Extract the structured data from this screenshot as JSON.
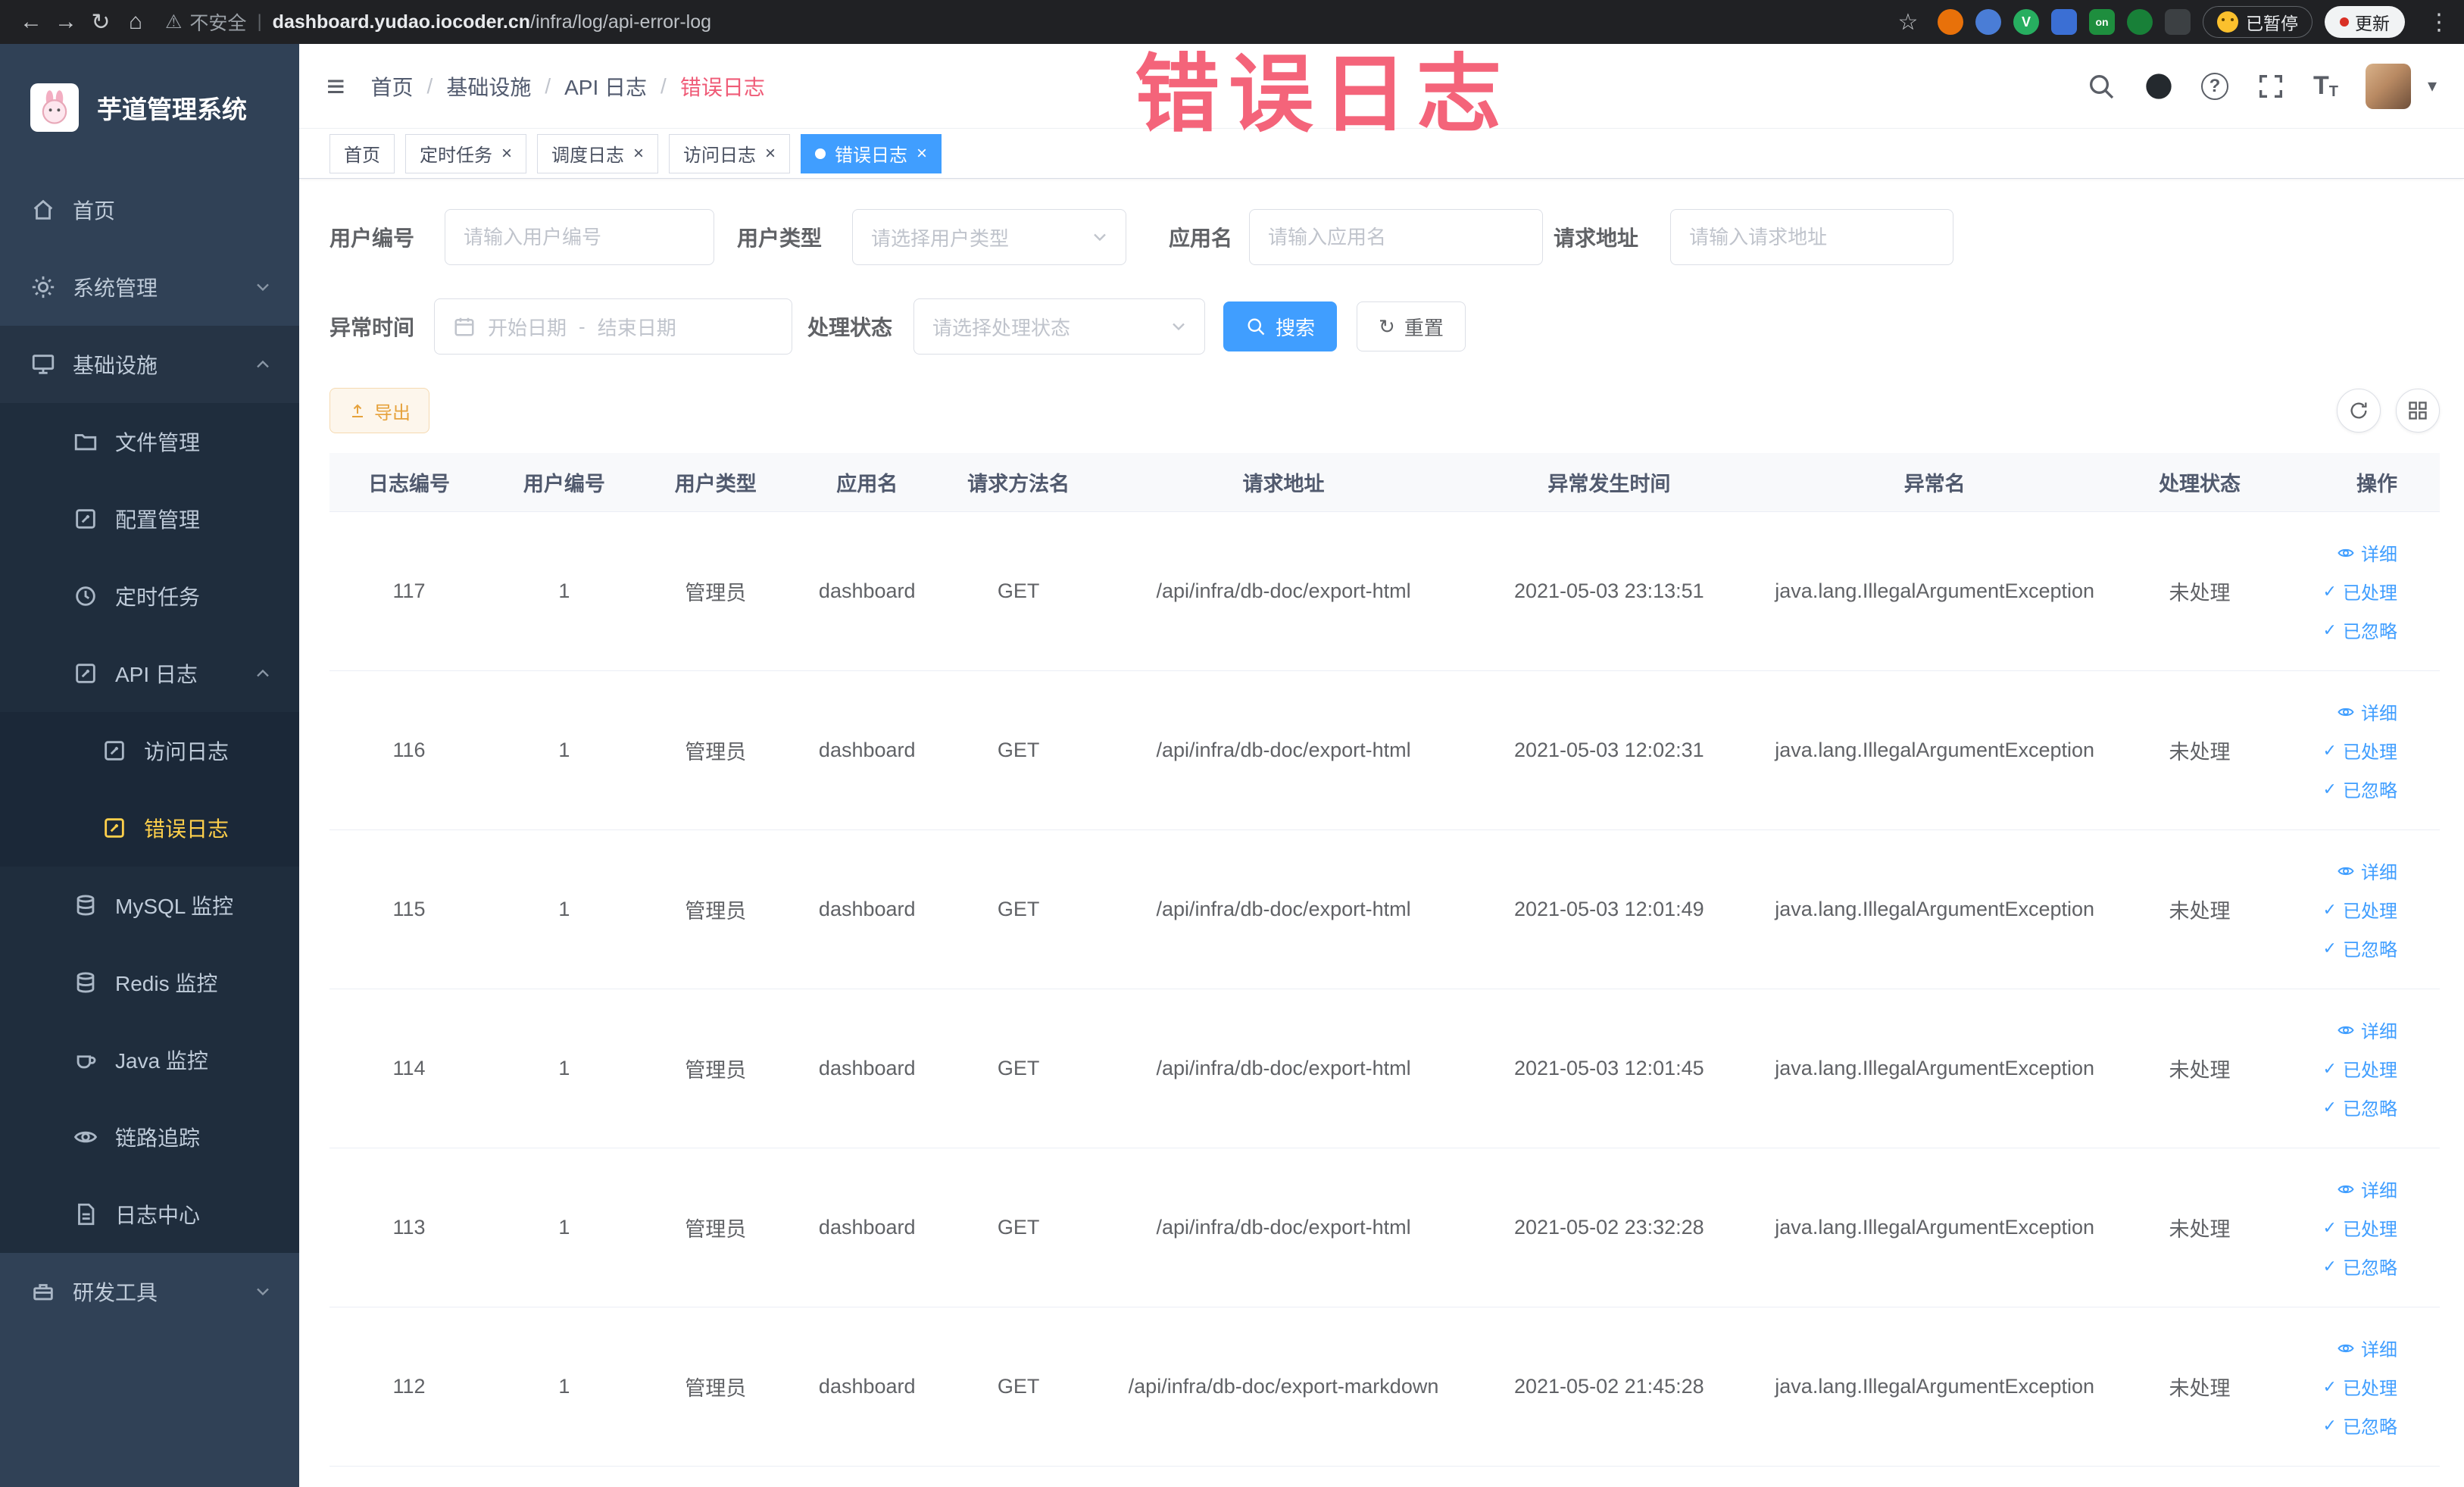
{
  "annotation": {
    "text": "错误日志"
  },
  "icons": {
    "back": "←",
    "forward": "→",
    "reload": "↻",
    "home": "⌂",
    "warning": "⚠",
    "star": "☆",
    "more": "⋮",
    "separator": "|",
    "hamburger": "≡",
    "question": "?",
    "caret_down": "▾",
    "check": "✓",
    "close": "×",
    "font_size": "T",
    "v_badge": "V"
  },
  "browser": {
    "security_label": "不安全",
    "url_domain": "dashboard.yudao.iocoder.cn",
    "url_path": "/infra/log/api-error-log",
    "paused_label": "已暂停",
    "update_label": "更新",
    "extension_badge": "on"
  },
  "sidebar": {
    "logo_title": "芋道管理系统",
    "items": [
      {
        "label": "首页"
      },
      {
        "label": "系统管理"
      },
      {
        "label": "基础设施"
      },
      {
        "label": "文件管理"
      },
      {
        "label": "配置管理"
      },
      {
        "label": "定时任务"
      },
      {
        "label": "API 日志"
      },
      {
        "label": "访问日志"
      },
      {
        "label": "错误日志"
      },
      {
        "label": "MySQL 监控"
      },
      {
        "label": "Redis 监控"
      },
      {
        "label": "Java 监控"
      },
      {
        "label": "链路追踪"
      },
      {
        "label": "日志中心"
      },
      {
        "label": "研发工具"
      }
    ]
  },
  "breadcrumb": {
    "separator": "/",
    "items": [
      "首页",
      "基础设施",
      "API 日志",
      "错误日志"
    ]
  },
  "tabs": [
    {
      "label": "首页"
    },
    {
      "label": "定时任务"
    },
    {
      "label": "调度日志"
    },
    {
      "label": "访问日志"
    },
    {
      "label": "错误日志"
    }
  ],
  "filters": {
    "user_id_label": "用户编号",
    "user_id_placeholder": "请输入用户编号",
    "user_type_label": "用户类型",
    "user_type_placeholder": "请选择用户类型",
    "app_name_label": "应用名",
    "app_name_placeholder": "请输入应用名",
    "request_url_label": "请求地址",
    "request_url_placeholder": "请输入请求地址",
    "exception_time_label": "异常时间",
    "start_placeholder": "开始日期",
    "range_separator": "-",
    "end_placeholder": "结束日期",
    "process_status_label": "处理状态",
    "process_status_placeholder": "请选择处理状态",
    "search_label": "搜索",
    "reset_label": "重置"
  },
  "toolbar": {
    "export_label": "导出"
  },
  "table": {
    "headers": [
      "日志编号",
      "用户编号",
      "用户类型",
      "应用名",
      "请求方法名",
      "请求地址",
      "异常发生时间",
      "异常名",
      "处理状态",
      "操作"
    ],
    "action_labels": [
      "详细",
      "已处理",
      "已忽略"
    ],
    "rows": [
      {
        "id": "117",
        "user_id": "1",
        "user_type": "管理员",
        "app_name": "dashboard",
        "method": "GET",
        "url": "/api/infra/db-doc/export-html",
        "time": "2021-05-03 23:13:51",
        "exception": "java.lang.IllegalArgumentException",
        "status": "未处理"
      },
      {
        "id": "116",
        "user_id": "1",
        "user_type": "管理员",
        "app_name": "dashboard",
        "method": "GET",
        "url": "/api/infra/db-doc/export-html",
        "time": "2021-05-03 12:02:31",
        "exception": "java.lang.IllegalArgumentException",
        "status": "未处理"
      },
      {
        "id": "115",
        "user_id": "1",
        "user_type": "管理员",
        "app_name": "dashboard",
        "method": "GET",
        "url": "/api/infra/db-doc/export-html",
        "time": "2021-05-03 12:01:49",
        "exception": "java.lang.IllegalArgumentException",
        "status": "未处理"
      },
      {
        "id": "114",
        "user_id": "1",
        "user_type": "管理员",
        "app_name": "dashboard",
        "method": "GET",
        "url": "/api/infra/db-doc/export-html",
        "time": "2021-05-03 12:01:45",
        "exception": "java.lang.IllegalArgumentException",
        "status": "未处理"
      },
      {
        "id": "113",
        "user_id": "1",
        "user_type": "管理员",
        "app_name": "dashboard",
        "method": "GET",
        "url": "/api/infra/db-doc/export-html",
        "time": "2021-05-02 23:32:28",
        "exception": "java.lang.IllegalArgumentException",
        "status": "未处理"
      },
      {
        "id": "112",
        "user_id": "1",
        "user_type": "管理员",
        "app_name": "dashboard",
        "method": "GET",
        "url": "/api/infra/db-doc/export-markdown",
        "time": "2021-05-02 21:45:28",
        "exception": "java.lang.IllegalArgumentException",
        "status": "未处理"
      }
    ]
  }
}
